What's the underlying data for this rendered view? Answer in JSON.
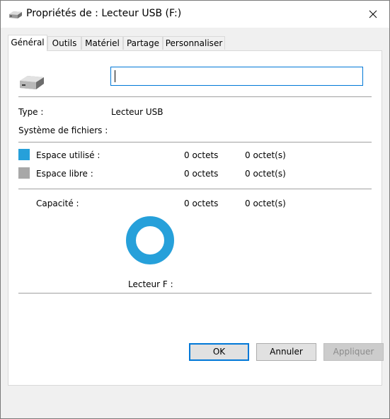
{
  "window": {
    "title": "Propriétés de : Lecteur USB (F:)",
    "icon": "usb-drive-icon"
  },
  "tabs": [
    {
      "label": "Général",
      "active": true
    },
    {
      "label": "Outils",
      "active": false
    },
    {
      "label": "Matériel",
      "active": false
    },
    {
      "label": "Partage",
      "active": false
    },
    {
      "label": "Personnaliser",
      "active": false
    }
  ],
  "general": {
    "name_value": "",
    "type_label": "Type :",
    "type_value": "Lecteur USB",
    "filesystem_label": "Système de fichiers :",
    "filesystem_value": "",
    "used_label": "Espace utilisé :",
    "used_bytes": "0 octets",
    "used_size": "0 octet(s)",
    "free_label": "Espace libre :",
    "free_bytes": "0 octets",
    "free_size": "0 octet(s)",
    "capacity_label": "Capacité :",
    "capacity_bytes": "0 octets",
    "capacity_size": "0 octet(s)",
    "drive_label": "Lecteur F :"
  },
  "colors": {
    "used": "#26a0da",
    "free": "#a8a8a8",
    "donut": "#26a0da"
  },
  "buttons": {
    "ok": "OK",
    "cancel": "Annuler",
    "apply": "Appliquer"
  }
}
